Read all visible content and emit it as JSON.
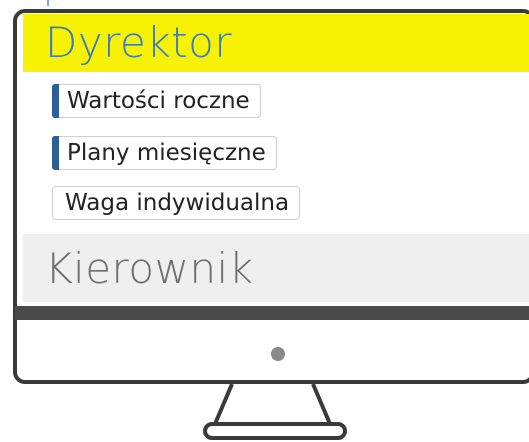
{
  "roles": [
    {
      "label": "Dyrektor",
      "active": true,
      "items": [
        {
          "label": "Wartości roczne",
          "selected": true
        },
        {
          "label": "Plany miesięczne",
          "selected": true
        },
        {
          "label": "Waga indywidualna",
          "selected": false
        }
      ]
    },
    {
      "label": "Kierownik",
      "active": false
    }
  ],
  "colors": {
    "active_header_bg": "#f7f203",
    "active_header_text": "#3b7bbf",
    "inactive_header_bg": "#efefef",
    "inactive_header_text": "#6d6d6d",
    "selected_marker": "#2c5f97",
    "monitor_frame": "#3a3a3a"
  },
  "icons": [
    "monitor-illustration",
    "power-indicator-icon"
  ]
}
